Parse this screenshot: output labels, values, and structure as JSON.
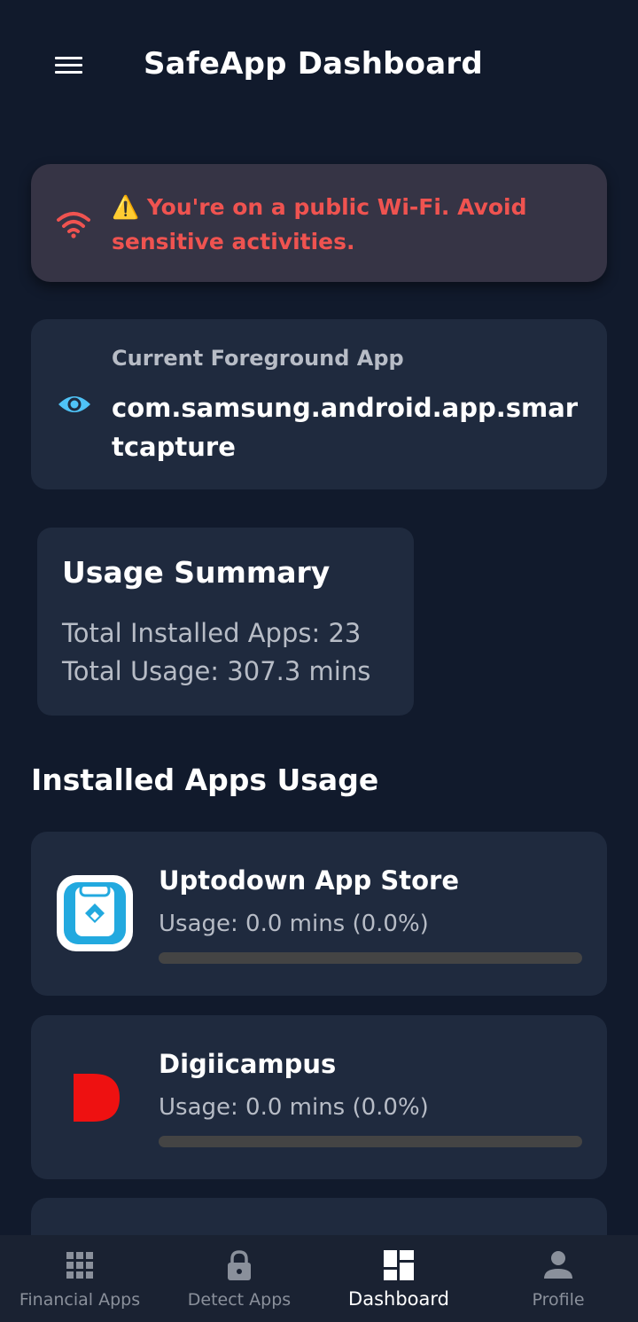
{
  "header": {
    "title": "SafeApp Dashboard",
    "menu_icon": "hamburger-menu-icon"
  },
  "alert": {
    "icon": "wifi-icon",
    "text": "⚠️ You're on a public Wi-Fi. Avoid sensitive activities.",
    "color": "#ef5350"
  },
  "foreground": {
    "icon": "eye-icon",
    "label": "Current Foreground App",
    "value": "com.samsung.android.app.smartcapture",
    "icon_color": "#4fc3f7"
  },
  "summary": {
    "title": "Usage Summary",
    "installed": "Total Installed Apps: 23",
    "usage": "Total Usage: 307.3 mins"
  },
  "installed_apps": {
    "title": "Installed Apps Usage",
    "items": [
      {
        "name": "Uptodown App Store",
        "usage": "Usage: 0.0 mins (0.0%)",
        "percent": 0.0,
        "icon": "uptodown-app-icon"
      },
      {
        "name": "Digiicampus",
        "usage": "Usage: 0.0 mins (0.0%)",
        "percent": 0.0,
        "icon": "digiicampus-app-icon"
      }
    ]
  },
  "bottom_nav": {
    "items": [
      {
        "label": "Financial Apps",
        "icon": "grid-icon",
        "active": false
      },
      {
        "label": "Detect Apps",
        "icon": "lock-icon",
        "active": false
      },
      {
        "label": "Dashboard",
        "icon": "dashboard-icon",
        "active": true
      },
      {
        "label": "Profile",
        "icon": "person-icon",
        "active": false
      }
    ]
  },
  "colors": {
    "background": "#111a2c",
    "card": "#1f2a3e",
    "alert_card": "#363445",
    "muted_text": "#b7bcc6",
    "nav_inactive": "#8a909b"
  }
}
